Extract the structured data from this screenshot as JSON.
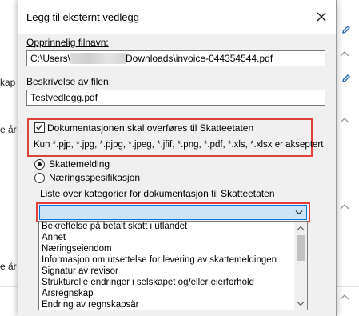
{
  "background": {
    "partial_texts": [
      "kap",
      "e år",
      "e år"
    ]
  },
  "dialog": {
    "title": "Legg til eksternt vedlegg",
    "original_filename": {
      "label": "Opprinnelig filnavn:",
      "value_prefix": "C:\\Users\\",
      "value_suffix": "Downloads\\invoice-044354544.pdf"
    },
    "description": {
      "label": "Beskrivelse av filen:",
      "value": "Testvedlegg.pdf"
    },
    "transfer_checkbox": {
      "label": "Dokumentasjonen skal overføres til Skatteetaten",
      "checked": true,
      "hint": "Kun *.pjp, *.jpg, *.pjpg, *.jpeg, *.jfif, *.png, *.pdf, *.xls, *.xlsx er akseptert"
    },
    "radio_options": [
      {
        "label": "Skattemelding",
        "selected": true
      },
      {
        "label": "Næringsspesifikasjon",
        "selected": false
      }
    ],
    "category": {
      "label": "Liste over kategorier for dokumentasjon til Skatteetaten",
      "selected_value": "",
      "options": [
        "Bekreftelse på betalt skatt i utlandet",
        "Annet",
        "Næringseiendom",
        "Informasjon om utsettelse for levering av skattemeldingen",
        "Signatur av revisor",
        "Strukturelle endringer i selskapet og/eller eierforhold",
        "Årsregnskap",
        "Endring av regnskapsår"
      ]
    }
  },
  "colors": {
    "highlight_red": "#e0413f",
    "combo_focus_blue": "#0078d7",
    "combo_fill": "#cce4f7",
    "pencil_blue": "#2b6cb0"
  },
  "icons": [
    "close-icon",
    "checkmark-icon",
    "chevron-down-icon",
    "pencil-icon",
    "chevron-up-icon",
    "scroll-up-icon",
    "scroll-down-icon"
  ]
}
